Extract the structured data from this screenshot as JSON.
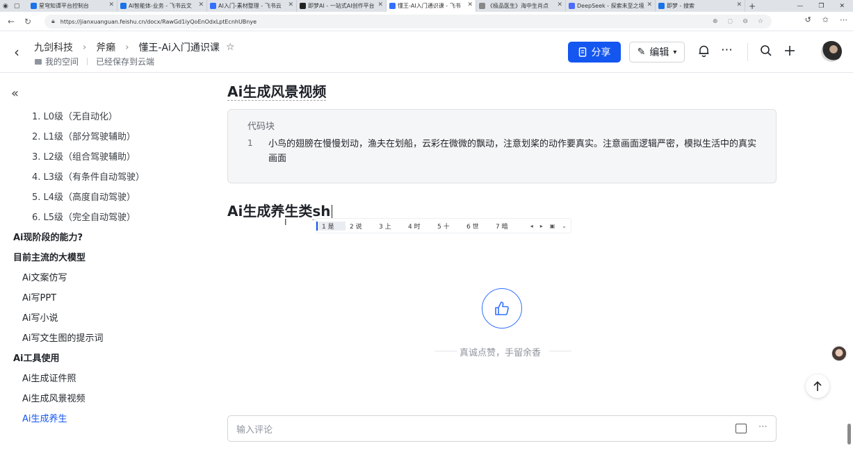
{
  "browser": {
    "tabs": [
      {
        "label": "星穹知谭平台控制台",
        "color": "#1a73e8",
        "active": false
      },
      {
        "label": "AI智能体-业务 - 飞书云文",
        "color": "#1a73e8",
        "active": false
      },
      {
        "label": "AI入门-素材整理 - 飞书云",
        "color": "#3370ff",
        "active": false
      },
      {
        "label": "即梦AI - 一站式AI创作平台",
        "color": "#222222",
        "active": false
      },
      {
        "label": "懂王-AI入门通识课 - 飞书",
        "color": "#3370ff",
        "active": true
      },
      {
        "label": "《极品医生》海中生肖点",
        "color": "#888888",
        "active": false
      },
      {
        "label": "DeepSeek - 探索未至之境",
        "color": "#4d6bfe",
        "active": false
      },
      {
        "label": "即梦 - 搜索",
        "color": "#1a73e8",
        "active": false
      }
    ],
    "url": "https://jianxuanguan.feishu.cn/docx/RawGd1iyQoEnOdxLptEcnhUBnye"
  },
  "header": {
    "crumbs": [
      "九剑科技",
      "斧癞",
      "懂王-Ai入门通识课"
    ],
    "space": "我的空间",
    "saved": "已经保存到云端",
    "share_label": "分享",
    "edit_label": "编辑"
  },
  "toc": [
    {
      "label": "1. L0级（无自动化）",
      "level": "l2"
    },
    {
      "label": "2. L1级（部分驾驶辅助）",
      "level": "l2"
    },
    {
      "label": "3. L2级（组合驾驶辅助）",
      "level": "l2"
    },
    {
      "label": "4. L3级（有条件自动驾驶）",
      "level": "l2"
    },
    {
      "label": "5. L4级（高度自动驾驶）",
      "level": "l2"
    },
    {
      "label": "6. L5级（完全自动驾驶）",
      "level": "l2"
    },
    {
      "label": "Ai现阶段的能力?",
      "level": "l1"
    },
    {
      "label": "目前主流的大模型",
      "level": "l1"
    },
    {
      "label": "Ai文案仿写",
      "level": "l1b"
    },
    {
      "label": "Ai写PPT",
      "level": "l1b"
    },
    {
      "label": "Ai写小说",
      "level": "l1b"
    },
    {
      "label": "Ai写文生图的提示词",
      "level": "l1b"
    },
    {
      "label": "Ai工具使用",
      "level": "l1"
    },
    {
      "label": "Ai生成证件照",
      "level": "l1b"
    },
    {
      "label": "Ai生成风景视频",
      "level": "l1b"
    },
    {
      "label": "Ai生成养生",
      "level": "l1b",
      "active": true
    }
  ],
  "doc": {
    "heading1": "Ai生成风景视频",
    "code_label": "代码块",
    "code_line_no": "1",
    "code_text": "小鸟的翅膀在慢慢划动，渔夫在划船，云彩在微微的飘动，注意划桨的动作要真实。注意画面逻辑严密，模拟生活中的真实画面",
    "heading2_prefix": "Ai生成养生类",
    "heading2_typing": "sh",
    "ime_candidates": [
      "1 是",
      "2 说",
      "3 上",
      "4 时",
      "5 十",
      "6 世",
      "7 暗"
    ],
    "like_text": "真诚点赞，手留余香",
    "comment_placeholder": "输入评论"
  },
  "colors": {
    "accent": "#1456f0"
  }
}
